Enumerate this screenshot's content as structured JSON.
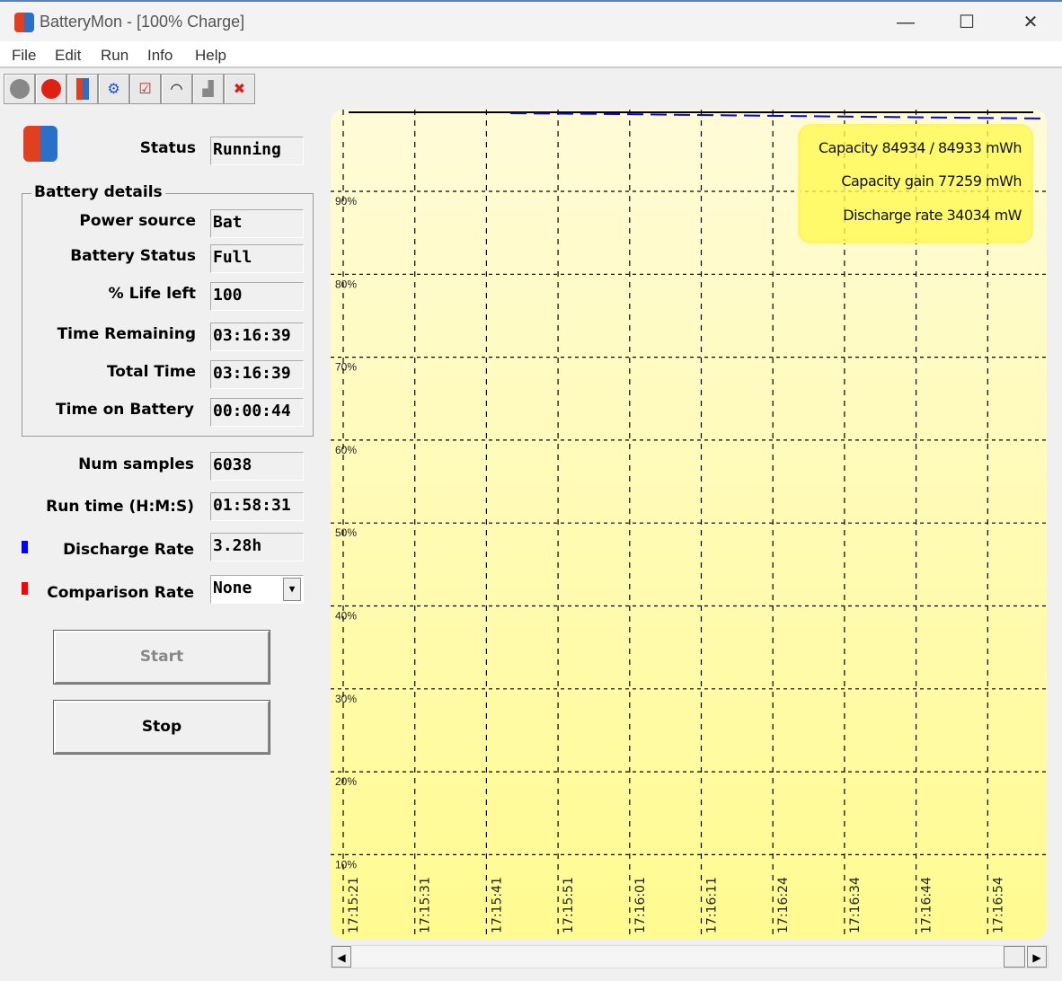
{
  "window": {
    "title": "BatteryMon - [100% Charge]",
    "minimize": "—",
    "maximize": "☐",
    "close": "✕"
  },
  "menu": [
    "File",
    "Edit",
    "Run",
    "Info",
    "Help"
  ],
  "toolbar": [
    "stop-gray-icon",
    "stop-sign-icon",
    "battery-icon",
    "gear-info-icon",
    "checklist-icon",
    "gauge-icon",
    "plug-icon",
    "remove-icon"
  ],
  "status": {
    "label": "Status",
    "value": "Running"
  },
  "battery_details": {
    "title": "Battery details",
    "fields": [
      {
        "label": "Power source",
        "value": "Bat"
      },
      {
        "label": "Battery Status",
        "value": "Full"
      },
      {
        "label": "% Life left",
        "value": "100"
      },
      {
        "label": "Time Remaining",
        "value": "03:16:39"
      },
      {
        "label": "Total Time",
        "value": "03:16:39"
      },
      {
        "label": "Time on Battery",
        "value": "00:00:44"
      }
    ]
  },
  "num_samples": {
    "label": "Num samples",
    "value": "6038"
  },
  "run_time": {
    "label": "Run time (H:M:S)",
    "value": "01:58:31"
  },
  "discharge_rate": {
    "label": "Discharge Rate",
    "value": "3.28h",
    "color": "#0000ff"
  },
  "comparison": {
    "label": "Comparison Rate",
    "value": "None",
    "color": "#ff0000"
  },
  "buttons": {
    "start": "Start",
    "stop": "Stop"
  },
  "chart": {
    "y_ticks": [
      "90%",
      "80%",
      "70%",
      "60%",
      "50%",
      "40%",
      "30%",
      "20%",
      "10%"
    ],
    "x_ticks": [
      "17:15:21",
      "17:15:31",
      "17:15:41",
      "17:15:51",
      "17:16:01",
      "17:16:11",
      "17:16:24",
      "17:16:34",
      "17:16:44",
      "17:16:54"
    ],
    "info": [
      "Capacity 84934 / 84933 mWh",
      "Capacity gain 77259 mWh",
      "Discharge rate 34034 mW"
    ],
    "background_color": "#fffb90",
    "line_color": "#0000ff"
  }
}
